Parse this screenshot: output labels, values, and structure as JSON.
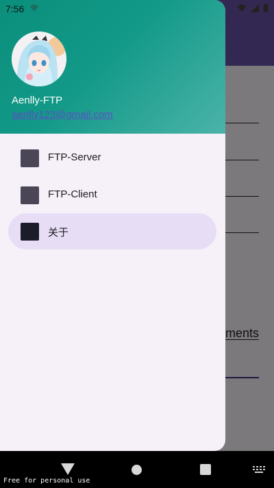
{
  "status_bar": {
    "time": "7:56"
  },
  "background_app": {
    "field_texts": [
      "",
      "",
      "",
      "",
      "ments",
      ""
    ]
  },
  "drawer": {
    "header": {
      "title": "Aenlly-FTP",
      "subtitle": "aenlly123@gmail.com"
    },
    "menu": [
      {
        "label": "FTP-Server",
        "active": false
      },
      {
        "label": "FTP-Client",
        "active": false
      },
      {
        "label": "关于",
        "active": true
      }
    ]
  },
  "nav_bar": {
    "watermark": "Free for personal use"
  },
  "colors": {
    "header_start": "#0b8f7c",
    "header_end": "#4bb3aa",
    "drawer_bg": "#f6f1f8",
    "active_item_bg": "#e7def6",
    "app_bar": "#6750a4"
  }
}
